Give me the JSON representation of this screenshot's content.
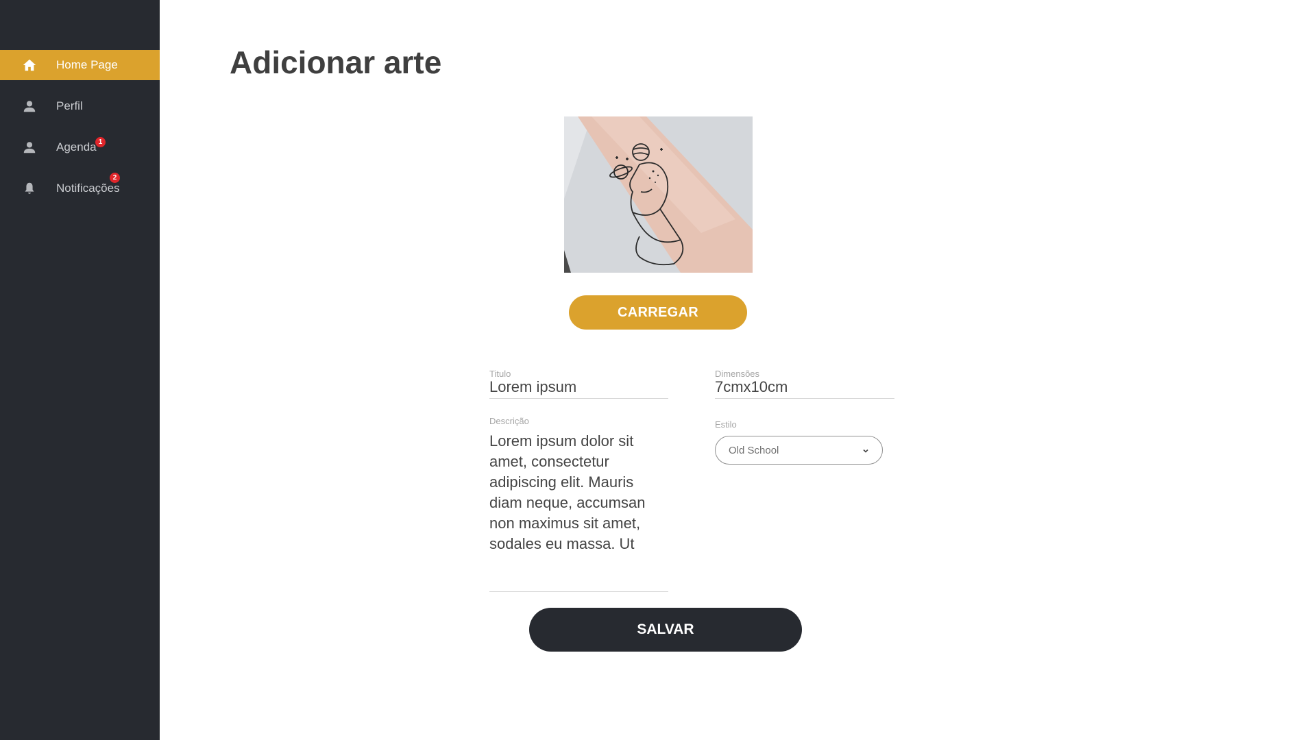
{
  "sidebar": {
    "items": [
      {
        "label": "Home Page",
        "icon": "home-icon",
        "active": true
      },
      {
        "label": "Perfil",
        "icon": "user-icon"
      },
      {
        "label": "Agenda",
        "icon": "user-icon",
        "badge": "1"
      },
      {
        "label": "Notificações",
        "icon": "bell-icon",
        "badge": "2"
      }
    ]
  },
  "page": {
    "title": "Adicionar arte",
    "upload_label": "CARREGAR",
    "save_label": "SALVAR"
  },
  "form": {
    "titulo": {
      "label": "Titulo",
      "value": "Lorem ipsum"
    },
    "dimensoes": {
      "label": "Dimensões",
      "value": "7cmx10cm"
    },
    "descricao": {
      "label": "Descrição",
      "value": "Lorem ipsum dolor sit amet, consectetur adipiscing elit. Mauris diam neque, accumsan non maximus sit amet, sodales eu massa. Ut"
    },
    "estilo": {
      "label": "Estilo",
      "value": "Old School"
    }
  },
  "colors": {
    "accent": "#dba22d",
    "sidebar_bg": "#272a30",
    "badge": "#e0262b"
  }
}
